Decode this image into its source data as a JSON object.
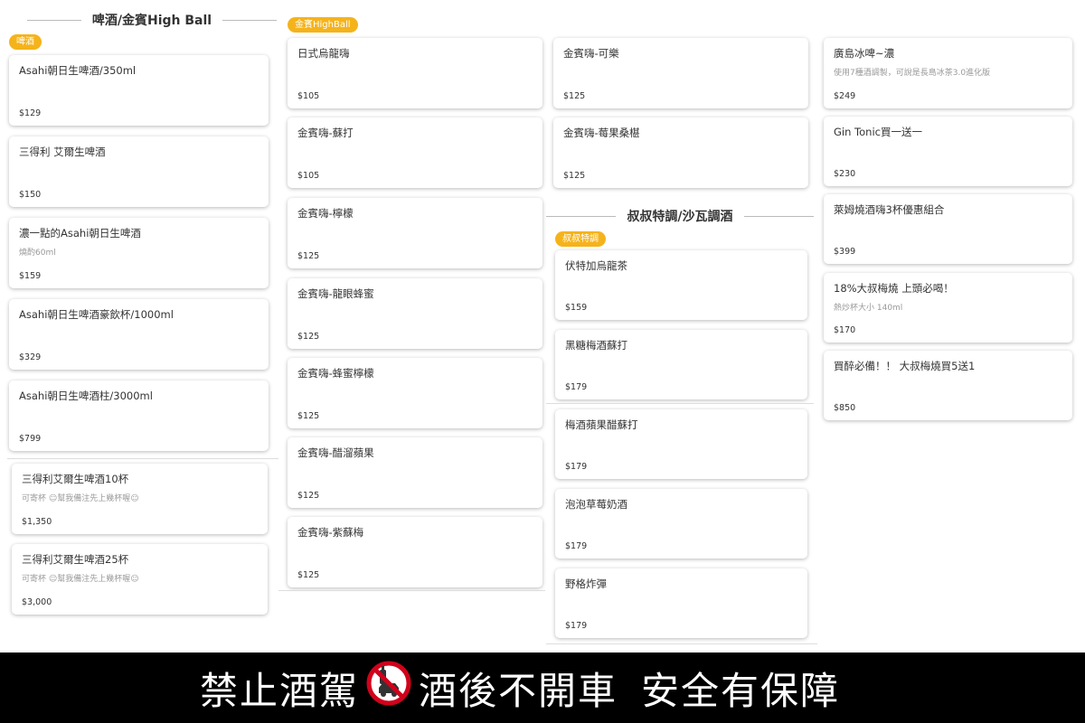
{
  "sections": {
    "beer_title": "啤酒/金賓High Ball",
    "shushu_title": "叔叔特調/沙瓦調酒"
  },
  "badges": {
    "beer": "啤酒",
    "highball": "金賓HighBall",
    "shushu": "叔叔特調"
  },
  "col1": [
    {
      "name": "Asahi朝日生啤酒/350ml",
      "desc": "",
      "price": "$129"
    },
    {
      "name": "三得利 艾爾生啤酒",
      "desc": "",
      "price": "$150"
    },
    {
      "name": "濃一點的Asahi朝日生啤酒",
      "desc": "燒酌60ml",
      "price": "$159"
    },
    {
      "name": "Asahi朝日生啤酒豪飲杯/1000ml",
      "desc": "",
      "price": "$329"
    },
    {
      "name": "Asahi朝日生啤酒柱/3000ml",
      "desc": "",
      "price": "$799"
    }
  ],
  "col1b": [
    {
      "name": "三得利艾爾生啤酒10杯",
      "desc_a": "可寄杯",
      "desc_b": "幫我備注先上幾杯喔",
      "price": "$1,350"
    },
    {
      "name": "三得利艾爾生啤酒25杯",
      "desc_a": "可寄杯",
      "desc_b": "幫我備注先上幾杯喔",
      "price": "$3,000"
    }
  ],
  "col2": [
    {
      "name": "日式烏龍嗨",
      "price": "$105"
    },
    {
      "name": "金賓嗨-蘇打",
      "price": "$105"
    },
    {
      "name": "金賓嗨-檸檬",
      "price": "$125"
    },
    {
      "name": "金賓嗨-龍眼蜂蜜",
      "price": "$125"
    },
    {
      "name": "金賓嗨-蜂蜜檸檬",
      "price": "$125"
    },
    {
      "name": "金賓嗨-醋溜蘋果",
      "price": "$125"
    },
    {
      "name": "金賓嗨-紫蘇梅",
      "price": "$125"
    }
  ],
  "col3a": [
    {
      "name": "金賓嗨-可樂",
      "price": "$125"
    },
    {
      "name": "金賓嗨-莓果桑椹",
      "price": "$125"
    }
  ],
  "col3b": [
    {
      "name": "伏特加烏龍茶",
      "price": "$159"
    },
    {
      "name": "黑糖梅酒蘇打",
      "price": "$179"
    },
    {
      "name": "梅酒蘋果醋蘇打",
      "price": "$179"
    },
    {
      "name": "泡泡草莓奶酒",
      "price": "$179"
    },
    {
      "name": "野格炸彈",
      "price": "$179"
    }
  ],
  "col4": [
    {
      "name": "廣島冰啤~濃",
      "desc": "使用7種酒調製，可說是長島冰茶3.0進化版",
      "price": "$249"
    },
    {
      "name": "Gin Tonic買一送一",
      "desc": "",
      "price": "$230"
    },
    {
      "name": "萊姆燒酒嗨3杯優惠組合",
      "desc": "",
      "price": "$399"
    },
    {
      "name": "18%大叔梅燒 上頭必喝！",
      "desc": "熱炒杯大小 140ml",
      "price": "$170"
    },
    {
      "name": "買醉必備！！ 大叔梅燒買5送1",
      "desc": "",
      "price": "$850"
    }
  ],
  "footer": {
    "text_a": "禁止酒駕",
    "text_b": "酒後不開車",
    "text_c": "安全有保障",
    "sign_icon": "no-drink-driving-icon"
  },
  "colors": {
    "badge": "#f5b31b",
    "footer_bg": "#000000",
    "footer_text": "#ffffff"
  }
}
